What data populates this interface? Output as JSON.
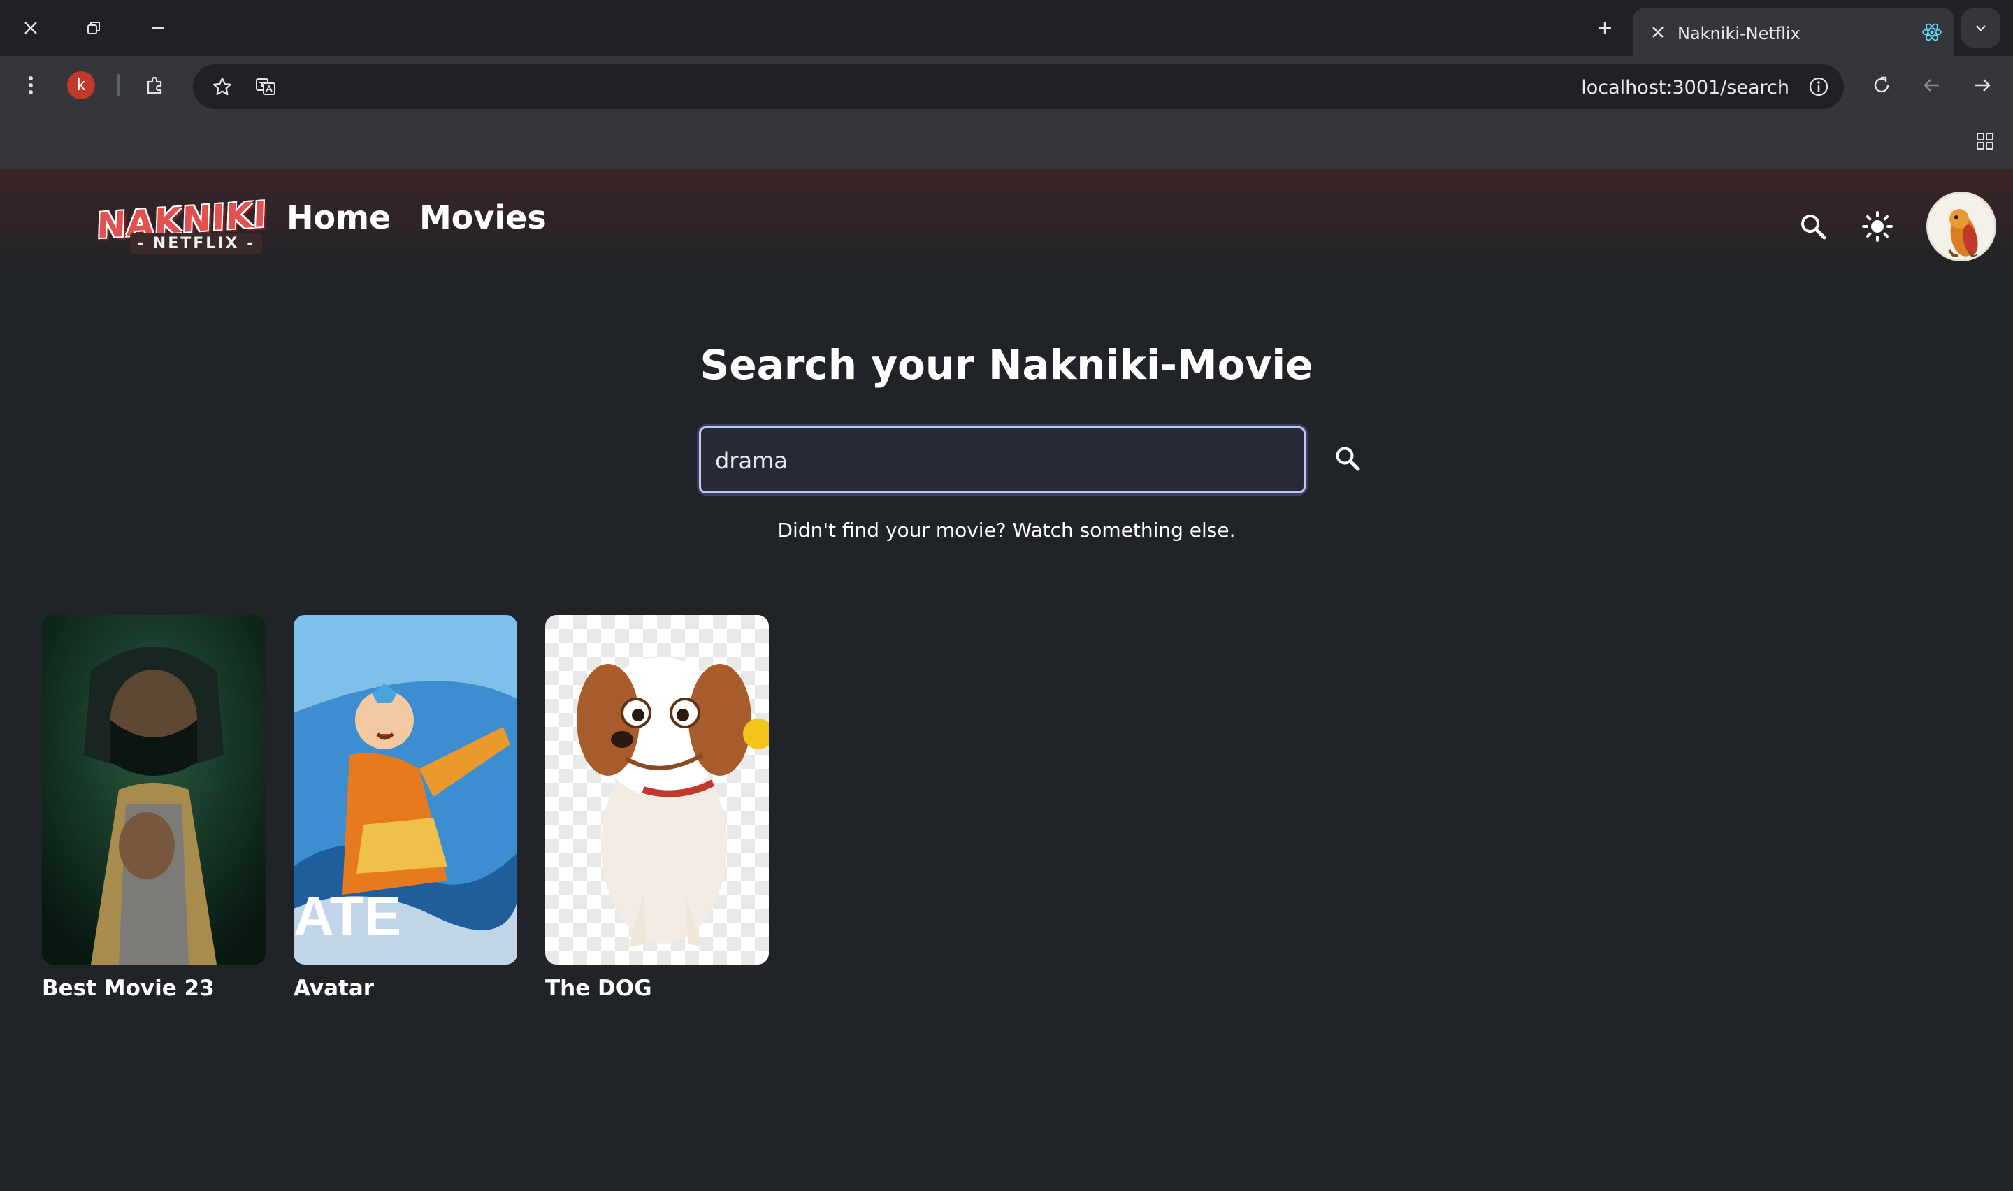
{
  "browser": {
    "tab_title": "Nakniki-Netflix",
    "url": "localhost:3001/search",
    "profile_initial": "k"
  },
  "app": {
    "logo_main": "NAKNIKI",
    "logo_sub": "NETFLIX",
    "nav": [
      {
        "label": "Home"
      },
      {
        "label": "Movies"
      }
    ],
    "page_title": "Search your Nakniki-Movie",
    "search": {
      "value": "drama",
      "placeholder": ""
    },
    "hint": "Didn't find your movie? Watch something else.",
    "results": [
      {
        "title": "Best Movie 23",
        "poster": "hooded-ninja-basketball"
      },
      {
        "title": "Avatar",
        "poster": "avatar-airbender",
        "poster_text": "ATE"
      },
      {
        "title": "The DOG",
        "poster": "cavalier-puppy"
      }
    ]
  },
  "colors": {
    "background": "#202327",
    "header_gradient_top": "#3b2528",
    "accent_red": "#e35050",
    "input_border": "#c4c7e6"
  }
}
